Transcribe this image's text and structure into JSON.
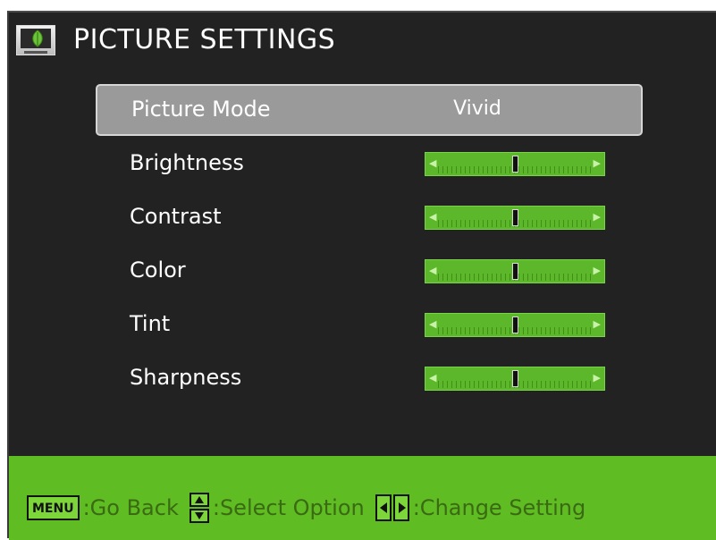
{
  "header": {
    "title": "PICTURE SETTINGS",
    "icon": "picture-settings-icon"
  },
  "menu": {
    "selected_index": 0,
    "items": [
      {
        "label": "Picture Mode",
        "value": "Vivid",
        "type": "option"
      },
      {
        "label": "Brightness",
        "type": "slider",
        "level": 0.5
      },
      {
        "label": "Contrast",
        "type": "slider",
        "level": 0.5
      },
      {
        "label": "Color",
        "type": "slider",
        "level": 0.5
      },
      {
        "label": "Tint",
        "type": "slider",
        "level": 0.5
      },
      {
        "label": "Sharpness",
        "type": "slider",
        "level": 0.5
      }
    ]
  },
  "footer": {
    "menu_key": "MENU",
    "go_back": ":Go Back",
    "select_option": ":Select Option",
    "change_setting": ":Change Setting"
  },
  "colors": {
    "panel_bg": "#222222",
    "accent_green": "#5fbc22",
    "slider_green": "#5cb82a",
    "selected_row": "#9a9a9a"
  }
}
